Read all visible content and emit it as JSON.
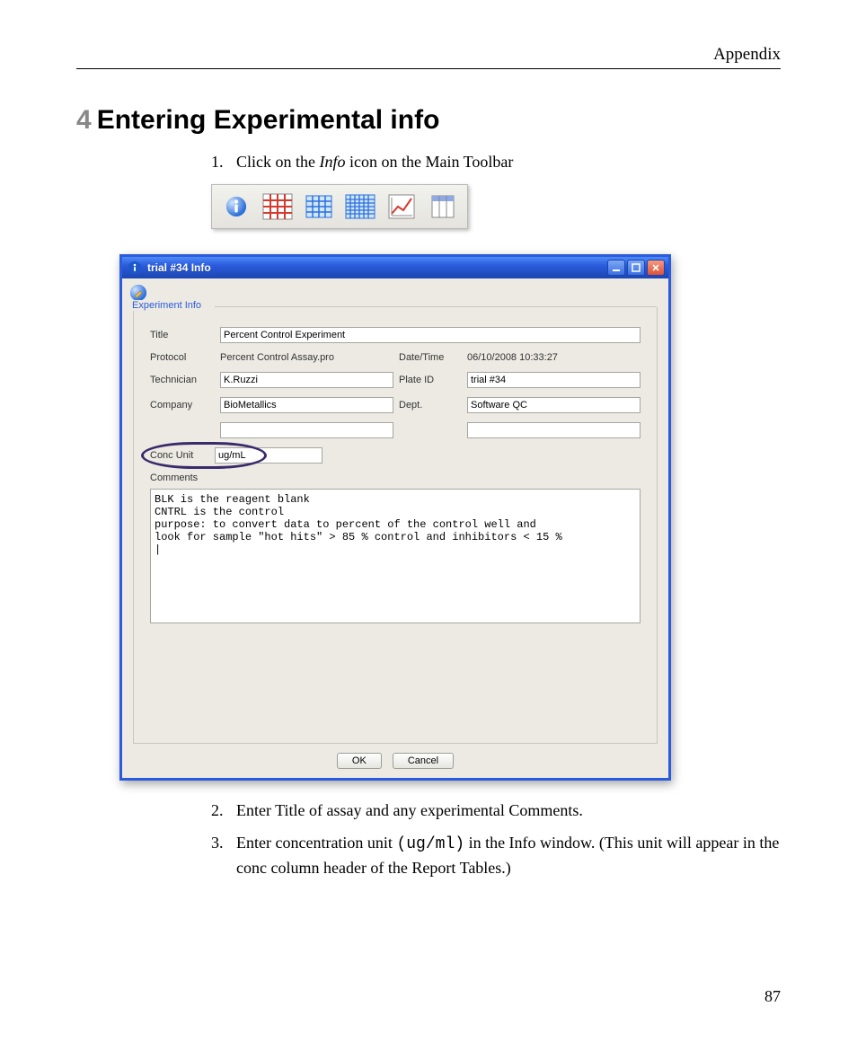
{
  "header": {
    "right": "Appendix"
  },
  "section": {
    "number": "4",
    "title": "Entering Experimental info"
  },
  "steps": {
    "s1": {
      "n": "1.",
      "text_pre": "Click on the ",
      "text_em": "Info",
      "text_post": " icon on the Main Toolbar"
    },
    "s2": {
      "n": "2.",
      "text": "Enter Title of assay and any experimental Comments."
    },
    "s3": {
      "n": "3.",
      "text_pre": "Enter concentration unit ",
      "code": "(ug/ml)",
      "text_post": " in the Info window. (This unit will appear in the conc column header of the Report Tables.)"
    }
  },
  "window": {
    "title": "trial #34 Info",
    "frame_legend": "Experiment Info",
    "fields": {
      "title_label": "Title",
      "title_value": "Percent Control Experiment",
      "protocol_label": "Protocol",
      "protocol_value": "Percent Control Assay.pro",
      "datetime_label": "Date/Time",
      "datetime_value": "06/10/2008 10:33:27",
      "technician_label": "Technician",
      "technician_value": "K.Ruzzi",
      "plateid_label": "Plate ID",
      "plateid_value": "trial #34",
      "company_label": "Company",
      "company_value": "BioMetallics",
      "dept_label": "Dept.",
      "dept_value": "Software QC",
      "extra_left": "",
      "extra_right": "",
      "concunit_label": "Conc Unit",
      "concunit_value": "ug/mL",
      "comments_label": "Comments",
      "comments_value": "BLK is the reagent blank\nCNTRL is the control\npurpose: to convert data to percent of the control well and\nlook for sample \"hot hits\" > 85 % control and inhibitors < 15 %\n|"
    },
    "buttons": {
      "ok": "OK",
      "cancel": "Cancel"
    }
  },
  "footer": {
    "page": "87"
  }
}
